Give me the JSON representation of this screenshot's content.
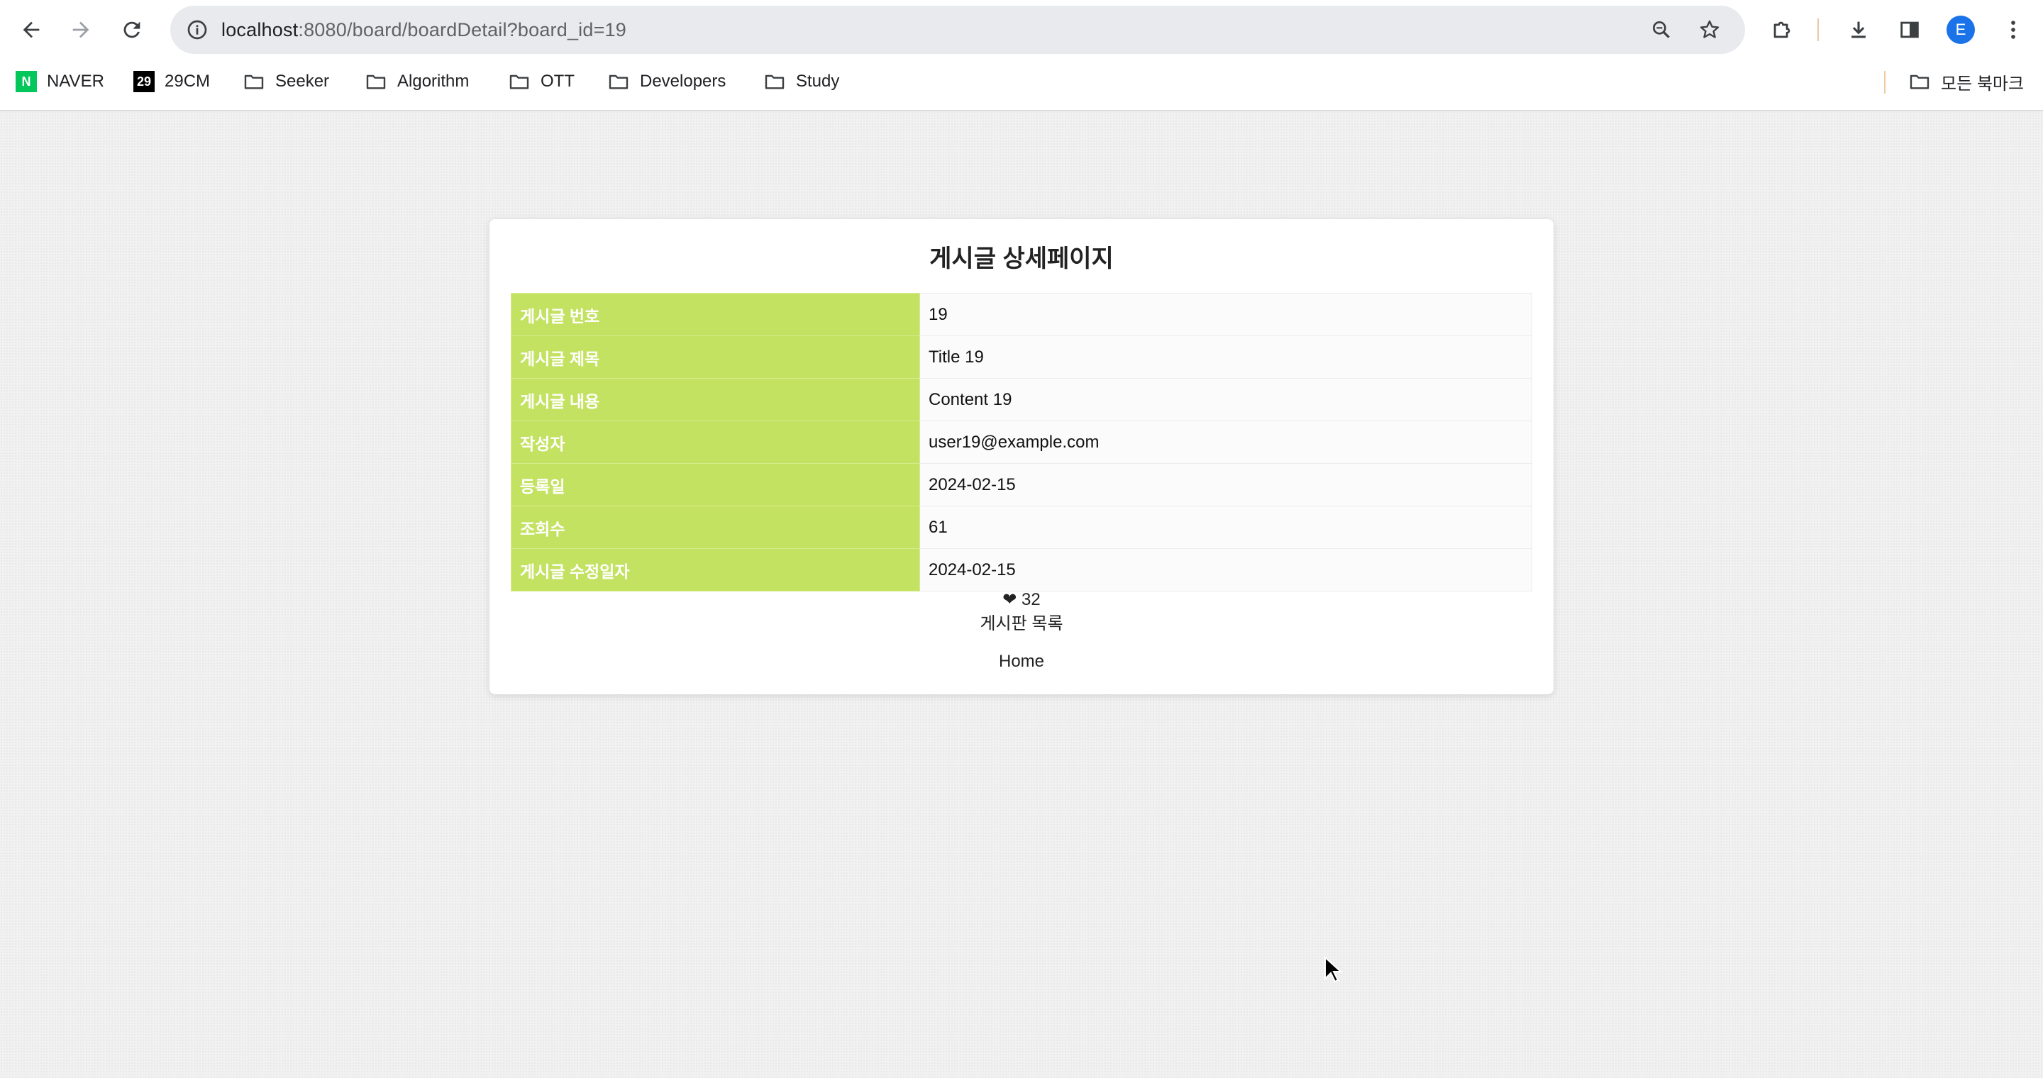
{
  "browser": {
    "url_host": "localhost",
    "url_rest": ":8080/board/boardDetail?board_id=19",
    "profile_initial": "E",
    "bookmarks": [
      {
        "label": "NAVER",
        "icon": "naver-favicon"
      },
      {
        "label": "29CM",
        "icon": "29cm-favicon"
      },
      {
        "label": "Seeker",
        "icon": "folder-icon"
      },
      {
        "label": "Algorithm",
        "icon": "folder-icon"
      },
      {
        "label": "OTT",
        "icon": "folder-icon"
      },
      {
        "label": "Developers",
        "icon": "folder-icon"
      },
      {
        "label": "Study",
        "icon": "folder-icon"
      }
    ],
    "all_bookmarks_label": "모든 북마크",
    "naver_fav_text": "N",
    "cm_fav_text": "29"
  },
  "page": {
    "title": "게시글 상세페이지",
    "rows": [
      {
        "label": "게시글 번호",
        "value": "19"
      },
      {
        "label": "게시글 제목",
        "value": "Title 19"
      },
      {
        "label": "게시글 내용",
        "value": "Content 19"
      },
      {
        "label": "작성자",
        "value": "user19@example.com"
      },
      {
        "label": "등록일",
        "value": "2024-02-15"
      },
      {
        "label": "조회수",
        "value": "61"
      },
      {
        "label": "게시글 수정일자",
        "value": "2024-02-15"
      }
    ],
    "like_symbol": "❤",
    "like_count": "32",
    "board_list_label": "게시판 목록",
    "home_label": "Home"
  },
  "colors": {
    "header_cell": "#c4e262",
    "avatar": "#1a73e8",
    "naver_green": "#03c75a"
  }
}
